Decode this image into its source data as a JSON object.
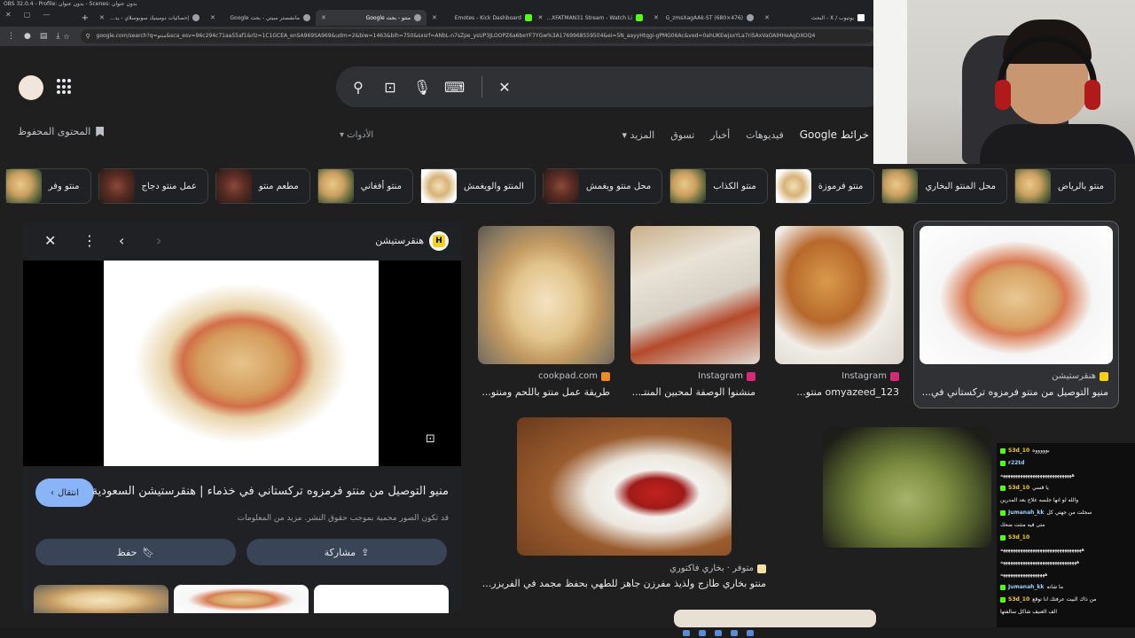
{
  "window_title": "OBS 32.0.4 - Profile: بدون عنوان - Scenes: بدون عنوان",
  "tabs": [
    {
      "label": "يوتيوب / X - البحث",
      "icon": "x-icon",
      "active": false
    },
    {
      "label": "G_zmsXagAAk-ST (680×476)",
      "icon": "globe-icon",
      "active": false
    },
    {
      "label": "XFATMAN31 Stream - Watch Li...",
      "icon": "kick-icon",
      "active": false
    },
    {
      "label": "Emotes - Kick Dashboard",
      "icon": "kick-icon",
      "active": false
    },
    {
      "label": "منتو - بحث Google",
      "icon": "google-icon",
      "active": true
    },
    {
      "label": "مانشستر سيتي - بحث Google",
      "icon": "google-icon",
      "active": false
    },
    {
      "label": "إحصائيات دومينيك سوبوسلاي - يد...",
      "icon": "stats-icon",
      "active": false
    }
  ],
  "url": "google.com/search?q=منتو&sca_esv=96c294c71aa55af1&rlz=1C1GCEA_enSA969SA969&udm=2&biw=1463&bih=750&sxsrf=ANbL-n7sZpe_ysUP3JLOOPZ6a6beYF7YGw%3A1769968559504&ei=5N_aayyHtqgi-gPMG06Ac&ved=0ahUKEwjsxYLa7riSAxVaOAlHHeAgDXOQ4",
  "search": {
    "query": "",
    "clear_label": "✕"
  },
  "saved_label": "المحتوى المحفوظ",
  "nav": {
    "google_maps": "خرائط Google",
    "videos": "فيديوهات",
    "news": "أخبار",
    "shopping": "تسوق",
    "more": "المزيد",
    "tools": "الأدوات"
  },
  "chips": [
    {
      "label": "منتو بالرياض",
      "thumb": "dumplings"
    },
    {
      "label": "محل المنتو البخاري",
      "thumb": "dumplings"
    },
    {
      "label": "منتو فرموزة",
      "thumb": "light"
    },
    {
      "label": "منتو الكذاب",
      "thumb": "dumplings"
    },
    {
      "label": "محل منتو ويغمش",
      "thumb": "dark"
    },
    {
      "label": "المنتو والويغمش",
      "thumb": "light"
    },
    {
      "label": "منتو أفغاني",
      "thumb": "dumplings"
    },
    {
      "label": "مطعم منتو",
      "thumb": "dark"
    },
    {
      "label": "عمل منتو دجاج",
      "thumb": "dark"
    },
    {
      "label": "منتو وفر",
      "thumb": "dumplings"
    }
  ],
  "results": [
    {
      "source": "هنقرستيشن",
      "title": "منيو التوصيل من منتو فرمزوه تركستاني في...",
      "selected": true
    },
    {
      "source": "Instagram",
      "title": "omyazeed_123 منتو..."
    },
    {
      "source": "Instagram",
      "title": "منشنوا الوصفة لمحبين المنتـ..."
    },
    {
      "source": "cookpad.com",
      "title": "طريقة عمل منتو باللحم ومنتو..."
    },
    {
      "source": "متوفر · بخاري فاكتوري",
      "title": "منتو بخاري طازج ولذيذ مفرزن جاهز للطهي بحفظ مجمد في الفريزر..."
    }
  ],
  "panel": {
    "site_name": "هنقرستيشن",
    "site_badge": "H",
    "visit_label": "انتقال",
    "title": "منيو التوصيل من منتو فرمزوه تركستاني في خذماء | هنقرستيشن السعودية",
    "copyright": "قد تكون الصور محمية بموجب حقوق النشر. مزيد من المعلومات",
    "share_label": "مشاركة",
    "save_label": "حفظ"
  },
  "chat": [
    {
      "user": "S3d_10",
      "msg": "بوووووه"
    },
    {
      "user": "r22td",
      "msg": ""
    },
    {
      "user": "",
      "msg": "هههههههههههههههههههههههههههههه"
    },
    {
      "user": "S3d_10",
      "msg": "يا قسي"
    },
    {
      "user": "",
      "msg": "والله لو انها جلسه علاج بعد المدرين"
    },
    {
      "user": "Jumanah_kk",
      "msg": "سجلت من جهتي كل"
    },
    {
      "user": "",
      "msg": "متى فيه منتت ضحك"
    },
    {
      "user": "S3d_10",
      "msg": ""
    },
    {
      "user": "",
      "msg": "هههههههههههههههههههههههههههههههههه"
    },
    {
      "user": "",
      "msg": "هههههههههههههههههههههههههههههههه"
    },
    {
      "user": "",
      "msg": "ههههههههههههههههههه"
    },
    {
      "user": "Jumanah_kk",
      "msg": "ما شانه"
    },
    {
      "user": "S3d_10",
      "msg": "من ذاك البيت عرفتك انا توقع"
    },
    {
      "user": "",
      "msg": "الف العنيف شاكل سالفتها"
    }
  ],
  "accent": "#8ab4f8"
}
